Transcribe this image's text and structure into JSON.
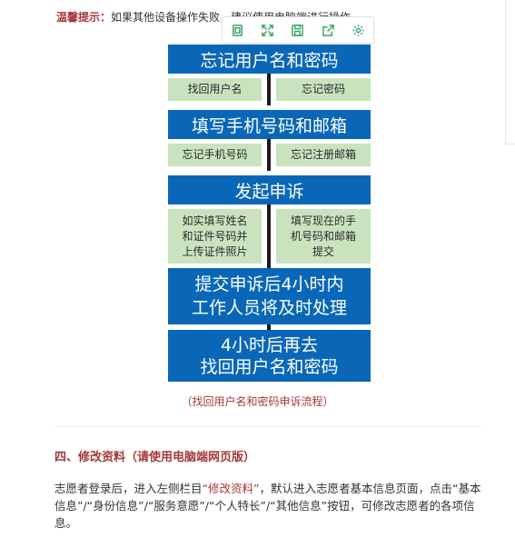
{
  "tip": {
    "label": "温馨提示：",
    "text": "如果其他设备操作失败，建议使用电脑端进行操作。"
  },
  "toolbar": {
    "icons": [
      "copy-icon",
      "expand-icon",
      "save-icon",
      "share-icon",
      "settings-icon"
    ]
  },
  "flowchart": {
    "step1": "忘记用户名和密码",
    "step1_left": "找回用户名",
    "step1_right": "忘记密码",
    "step2": "填写手机号码和邮箱",
    "step2_left": "忘记手机号码",
    "step2_right": "忘记注册邮箱",
    "step3": "发起申诉",
    "step3_left": [
      "如实填写姓名",
      "和证件号码并",
      "上传证件照片"
    ],
    "step3_right": [
      "填写现在的手",
      "机号码和邮箱",
      "提交"
    ],
    "step4": [
      "提交申诉后4小时内",
      "工作人员将及时处理"
    ],
    "step5": [
      "4小时后再去",
      "找回用户名和密码"
    ],
    "caption": "（找回用户名和密码申诉流程）"
  },
  "section": {
    "title": "四、修改资料（请使用电脑端网页版）",
    "para_part1": "志愿者登录后，进入左侧栏目",
    "para_link": "“修改资料”",
    "para_part2": "，默认进入志愿者基本信息页面，点击“基本信息”/“身份信息”/“服务意愿”/“个人特长”/“其他信息”按钮，可修改志愿者的各项信息。"
  },
  "colors": {
    "flow_blue": "#0a67b7",
    "flow_green": "#c9e3bf",
    "accent_red": "#a4373a",
    "icon_green": "#3ea66b"
  }
}
